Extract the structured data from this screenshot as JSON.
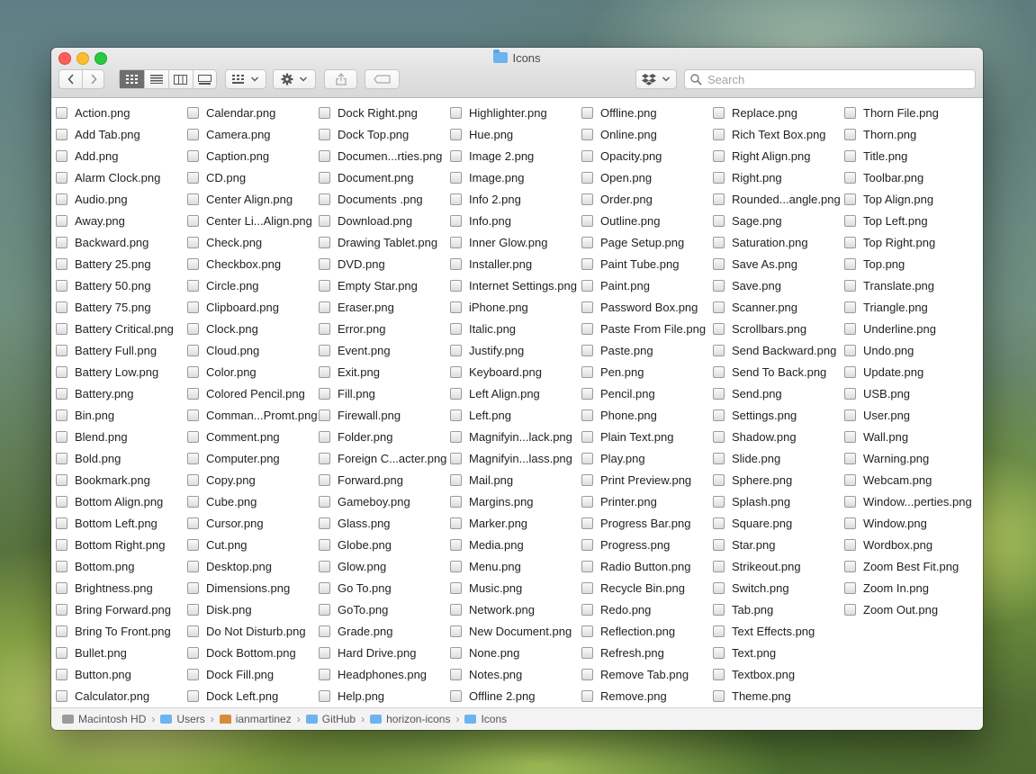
{
  "window": {
    "title": "Icons"
  },
  "toolbar": {
    "back_icon": "chevron-left-icon",
    "forward_icon": "chevron-right-icon",
    "view_modes": [
      "icon-view",
      "list-view",
      "column-view",
      "gallery-view"
    ],
    "action_icon": "gear-icon",
    "share_icon": "share-icon",
    "tag_icon": "tag-icon",
    "dropbox_icon": "dropbox-icon"
  },
  "search": {
    "placeholder": "Search",
    "value": ""
  },
  "files": [
    [
      "Action.png",
      "Add Tab.png",
      "Add.png",
      "Alarm Clock.png",
      "Audio.png",
      "Away.png",
      "Backward.png",
      "Battery 25.png",
      "Battery 50.png",
      "Battery 75.png",
      "Battery Critical.png",
      "Battery Full.png",
      "Battery Low.png",
      "Battery.png",
      "Bin.png",
      "Blend.png",
      "Bold.png",
      "Bookmark.png",
      "Bottom Align.png",
      "Bottom Left.png",
      "Bottom Right.png",
      "Bottom.png",
      "Brightness.png",
      "Bring Forward.png",
      "Bring To Front.png",
      "Bullet.png",
      "Button.png",
      "Calculator.png"
    ],
    [
      "Calendar.png",
      "Camera.png",
      "Caption.png",
      "CD.png",
      "Center Align.png",
      "Center Li...Align.png",
      "Check.png",
      "Checkbox.png",
      "Circle.png",
      "Clipboard.png",
      "Clock.png",
      "Cloud.png",
      "Color.png",
      "Colored Pencil.png",
      "Comman...Promt.png",
      "Comment.png",
      "Computer.png",
      "Copy.png",
      "Cube.png",
      "Cursor.png",
      "Cut.png",
      "Desktop.png",
      "Dimensions.png",
      "Disk.png",
      "Do Not Disturb.png",
      "Dock Bottom.png",
      "Dock Fill.png",
      "Dock Left.png"
    ],
    [
      "Dock Right.png",
      "Dock Top.png",
      "Documen...rties.png",
      "Document.png",
      "Documents .png",
      "Download.png",
      "Drawing Tablet.png",
      "DVD.png",
      "Empty Star.png",
      "Eraser.png",
      "Error.png",
      "Event.png",
      "Exit.png",
      "Fill.png",
      "Firewall.png",
      "Folder.png",
      "Foreign C...acter.png",
      "Forward.png",
      "Gameboy.png",
      "Glass.png",
      "Globe.png",
      "Glow.png",
      "Go To.png",
      "GoTo.png",
      "Grade.png",
      "Hard Drive.png",
      "Headphones.png",
      "Help.png"
    ],
    [
      "Highlighter.png",
      "Hue.png",
      "Image 2.png",
      "Image.png",
      "Info 2.png",
      "Info.png",
      "Inner Glow.png",
      "Installer.png",
      "Internet Settings.png",
      "iPhone.png",
      "Italic.png",
      "Justify.png",
      "Keyboard.png",
      "Left Align.png",
      "Left.png",
      "Magnifyin...lack.png",
      "Magnifyin...lass.png",
      "Mail.png",
      "Margins.png",
      "Marker.png",
      "Media.png",
      "Menu.png",
      "Music.png",
      "Network.png",
      "New Document.png",
      "None.png",
      "Notes.png",
      "Offline 2.png"
    ],
    [
      "Offline.png",
      "Online.png",
      "Opacity.png",
      "Open.png",
      "Order.png",
      "Outline.png",
      "Page Setup.png",
      "Paint Tube.png",
      "Paint.png",
      "Password Box.png",
      "Paste From File.png",
      "Paste.png",
      "Pen.png",
      "Pencil.png",
      "Phone.png",
      "Plain Text.png",
      "Play.png",
      "Print Preview.png",
      "Printer.png",
      "Progress Bar.png",
      "Progress.png",
      "Radio Button.png",
      "Recycle Bin.png",
      "Redo.png",
      "Reflection.png",
      "Refresh.png",
      "Remove Tab.png",
      "Remove.png"
    ],
    [
      "Replace.png",
      "Rich Text Box.png",
      "Right Align.png",
      "Right.png",
      "Rounded...angle.png",
      "Sage.png",
      "Saturation.png",
      "Save As.png",
      "Save.png",
      "Scanner.png",
      "Scrollbars.png",
      "Send Backward.png",
      "Send To Back.png",
      "Send.png",
      "Settings.png",
      "Shadow.png",
      "Slide.png",
      "Sphere.png",
      "Splash.png",
      "Square.png",
      "Star.png",
      "Strikeout.png",
      "Switch.png",
      "Tab.png",
      "Text Effects.png",
      "Text.png",
      "Textbox.png",
      "Theme.png"
    ],
    [
      "Thorn File.png",
      "Thorn.png",
      "Title.png",
      "Toolbar.png",
      "Top Align.png",
      "Top Left.png",
      "Top Right.png",
      "Top.png",
      "Translate.png",
      "Triangle.png",
      "Underline.png",
      "Undo.png",
      "Update.png",
      "USB.png",
      "User.png",
      "Wall.png",
      "Warning.png",
      "Webcam.png",
      "Window...perties.png",
      "Window.png",
      "Wordbox.png",
      "Zoom Best Fit.png",
      "Zoom In.png",
      "Zoom Out.png"
    ]
  ],
  "pathbar": [
    "Macintosh HD",
    "Users",
    "ianmartinez",
    "GitHub",
    "horizon-icons",
    "Icons"
  ]
}
